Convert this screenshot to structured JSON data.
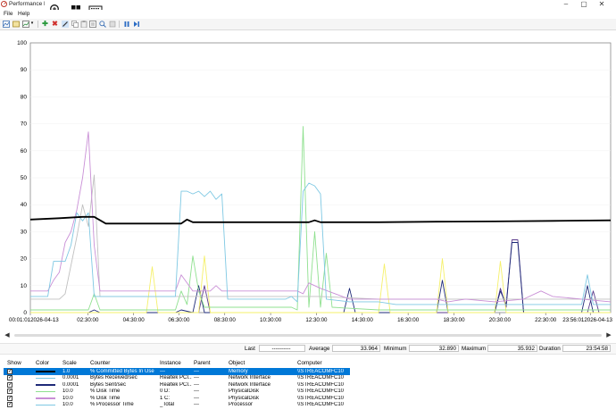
{
  "window": {
    "title": "Performance M",
    "controls": {
      "minimize": "–",
      "maximize": "▢",
      "close": "✕"
    }
  },
  "menu": {
    "items": [
      "File",
      "Help"
    ]
  },
  "chart_data": {
    "type": "line",
    "ylim": [
      0,
      100
    ],
    "yticks": [
      0,
      10,
      20,
      30,
      40,
      50,
      60,
      70,
      80,
      90,
      100
    ],
    "xlim": [
      0,
      100
    ],
    "xtick_labels": [
      {
        "x": 0,
        "label": "00:01:012026-04-13"
      },
      {
        "x": 9.9,
        "label": "02:30:00"
      },
      {
        "x": 17.8,
        "label": "04:30:00"
      },
      {
        "x": 25.6,
        "label": "06:30:00"
      },
      {
        "x": 33.5,
        "label": "08:30:00"
      },
      {
        "x": 41.4,
        "label": "10:30:00"
      },
      {
        "x": 49.3,
        "label": "12:30:00"
      },
      {
        "x": 57.2,
        "label": "14:30:00"
      },
      {
        "x": 65.1,
        "label": "16:30:00"
      },
      {
        "x": 73.0,
        "label": "18:30:00"
      },
      {
        "x": 80.9,
        "label": "20:30:00"
      },
      {
        "x": 88.8,
        "label": "22:30:00"
      },
      {
        "x": 96.5,
        "label": "23:56:012026-04-13"
      }
    ],
    "series": [
      {
        "color": "#000000",
        "points": [
          [
            0,
            34.5
          ],
          [
            5,
            35
          ],
          [
            9,
            35.5
          ],
          [
            11,
            35.5
          ],
          [
            13,
            33
          ],
          [
            20,
            33
          ],
          [
            26,
            33
          ],
          [
            27,
            34.5
          ],
          [
            28,
            33.5
          ],
          [
            40,
            33.5
          ],
          [
            48,
            33.5
          ],
          [
            49,
            34.2
          ],
          [
            50,
            33.5
          ],
          [
            60,
            33.5
          ],
          [
            70,
            33.7
          ],
          [
            80,
            33.8
          ],
          [
            90,
            34
          ],
          [
            100,
            34.2
          ]
        ]
      },
      {
        "color": "#7ec8e3",
        "points": [
          [
            0,
            6
          ],
          [
            3,
            6
          ],
          [
            4,
            19
          ],
          [
            6,
            19
          ],
          [
            7,
            25
          ],
          [
            8,
            37
          ],
          [
            9,
            34
          ],
          [
            10,
            37
          ],
          [
            11,
            6
          ],
          [
            12,
            6
          ],
          [
            20,
            6
          ],
          [
            25,
            6
          ],
          [
            26,
            45
          ],
          [
            27,
            45
          ],
          [
            28,
            44
          ],
          [
            29,
            45
          ],
          [
            30,
            43
          ],
          [
            31,
            45
          ],
          [
            32,
            42
          ],
          [
            33,
            44
          ],
          [
            34,
            5
          ],
          [
            41,
            5
          ],
          [
            44,
            5
          ],
          [
            45,
            6
          ],
          [
            46,
            4
          ],
          [
            47,
            45
          ],
          [
            48,
            48
          ],
          [
            49,
            47
          ],
          [
            50,
            44
          ],
          [
            51,
            5
          ],
          [
            55,
            4
          ],
          [
            60,
            4
          ],
          [
            63,
            3
          ],
          [
            70,
            3
          ],
          [
            75,
            3
          ],
          [
            80,
            3
          ],
          [
            85,
            3
          ],
          [
            90,
            3
          ],
          [
            95,
            3
          ],
          [
            96,
            14
          ],
          [
            97,
            3
          ],
          [
            100,
            3
          ]
        ]
      },
      {
        "color": "#c98fd6",
        "points": [
          [
            0,
            8
          ],
          [
            3,
            8
          ],
          [
            4,
            12
          ],
          [
            5,
            15
          ],
          [
            6,
            26
          ],
          [
            7,
            30
          ],
          [
            8,
            38
          ],
          [
            9,
            50
          ],
          [
            10,
            67
          ],
          [
            11,
            25
          ],
          [
            12,
            8
          ],
          [
            13,
            8
          ],
          [
            20,
            8
          ],
          [
            25,
            8
          ],
          [
            26,
            14
          ],
          [
            27,
            11
          ],
          [
            28,
            8
          ],
          [
            31,
            8
          ],
          [
            32,
            10
          ],
          [
            33,
            8
          ],
          [
            40,
            8
          ],
          [
            46,
            8
          ],
          [
            47,
            7
          ],
          [
            48,
            11
          ],
          [
            50,
            9
          ],
          [
            55,
            5
          ],
          [
            60,
            5
          ],
          [
            70,
            5
          ],
          [
            72,
            4
          ],
          [
            75,
            5
          ],
          [
            80,
            4
          ],
          [
            85,
            5
          ],
          [
            88,
            8
          ],
          [
            90,
            6
          ],
          [
            95,
            5
          ],
          [
            100,
            4
          ]
        ]
      },
      {
        "color": "#c0c0c0",
        "points": [
          [
            0,
            5
          ],
          [
            5,
            5
          ],
          [
            6,
            7
          ],
          [
            8,
            28
          ],
          [
            9,
            40
          ],
          [
            10,
            32
          ],
          [
            11,
            51
          ],
          [
            12,
            6
          ],
          [
            20,
            6
          ],
          [
            26,
            6
          ],
          [
            30,
            6
          ],
          [
            33,
            6
          ],
          [
            34,
            6
          ],
          [
            40,
            6
          ],
          [
            47,
            6
          ],
          [
            50,
            6
          ],
          [
            60,
            5
          ],
          [
            70,
            5
          ],
          [
            80,
            5
          ],
          [
            90,
            5
          ],
          [
            100,
            5
          ]
        ]
      },
      {
        "color": "#8fe08f",
        "points": [
          [
            0,
            1
          ],
          [
            10,
            1
          ],
          [
            11,
            7
          ],
          [
            12,
            1
          ],
          [
            20,
            1
          ],
          [
            25,
            1
          ],
          [
            26,
            8
          ],
          [
            27,
            3
          ],
          [
            28,
            21
          ],
          [
            29,
            8
          ],
          [
            30,
            2
          ],
          [
            35,
            2
          ],
          [
            40,
            2
          ],
          [
            45,
            2
          ],
          [
            46,
            1
          ],
          [
            47,
            69
          ],
          [
            48,
            2
          ],
          [
            49,
            30
          ],
          [
            50,
            2
          ],
          [
            51,
            22
          ],
          [
            52,
            2
          ],
          [
            60,
            1
          ],
          [
            70,
            1
          ],
          [
            80,
            1
          ],
          [
            90,
            1
          ],
          [
            100,
            1
          ]
        ]
      },
      {
        "color": "#f5f06a",
        "points": [
          [
            0,
            0
          ],
          [
            20,
            0
          ],
          [
            21,
            17
          ],
          [
            22,
            0
          ],
          [
            29,
            0
          ],
          [
            30,
            21
          ],
          [
            31,
            0
          ],
          [
            40,
            0
          ],
          [
            50,
            0
          ],
          [
            60,
            0
          ],
          [
            61,
            18
          ],
          [
            62,
            0
          ],
          [
            70,
            0
          ],
          [
            71,
            20
          ],
          [
            72,
            0
          ],
          [
            80,
            0
          ],
          [
            81,
            19
          ],
          [
            82,
            0
          ],
          [
            90,
            0
          ],
          [
            100,
            0
          ]
        ]
      },
      {
        "color": "#1e2a78",
        "points": [
          [
            0,
            0
          ],
          [
            10,
            0
          ],
          [
            11,
            1
          ],
          [
            12,
            0
          ],
          [
            25,
            0
          ],
          [
            26,
            1
          ],
          [
            28,
            0
          ],
          [
            29,
            10
          ],
          [
            30,
            0
          ],
          [
            50,
            0
          ],
          [
            54,
            0
          ],
          [
            55,
            9
          ],
          [
            56,
            0
          ],
          [
            70,
            0
          ],
          [
            71,
            12
          ],
          [
            72,
            0
          ],
          [
            80,
            0
          ],
          [
            81,
            8
          ],
          [
            82,
            3
          ],
          [
            83,
            26
          ],
          [
            84,
            26
          ],
          [
            85,
            0
          ],
          [
            95,
            0
          ],
          [
            96,
            10
          ],
          [
            97,
            0
          ],
          [
            100,
            0
          ]
        ]
      },
      {
        "color": "#5b3b8c",
        "points": [
          [
            0,
            0
          ],
          [
            20,
            0
          ],
          [
            29,
            0
          ],
          [
            30,
            10
          ],
          [
            31,
            0
          ],
          [
            70,
            0
          ],
          [
            80,
            0
          ],
          [
            81,
            9
          ],
          [
            82,
            2
          ],
          [
            83,
            27
          ],
          [
            84,
            27
          ],
          [
            85,
            0
          ],
          [
            96,
            0
          ],
          [
            97,
            8
          ],
          [
            98,
            0
          ],
          [
            100,
            0
          ]
        ]
      }
    ]
  },
  "stats": {
    "last_label": "Last",
    "last_value": "----------",
    "average_label": "Average",
    "average_value": "33.964",
    "minimum_label": "Minimum",
    "minimum_value": "32.890",
    "maximum_label": "Maximum",
    "maximum_value": "35.932",
    "duration_label": "Duration",
    "duration_value": "23:54:58"
  },
  "legend": {
    "headers": {
      "show": "Show",
      "color": "Color",
      "scale": "Scale",
      "counter": "Counter",
      "instance": "Instance",
      "parent": "Parent",
      "object": "Object",
      "computer": "Computer"
    },
    "rows": [
      {
        "color": "#000000",
        "scale": "1.0",
        "counter": "% Committed Bytes In Use",
        "instance": "---",
        "parent": "---",
        "object": "Memory",
        "computer": "\\\\STREACOMFC10",
        "selected": true
      },
      {
        "color": "#7ec8e3",
        "scale": "0.0001",
        "counter": "Bytes Received/sec",
        "instance": "Realtek PCI...",
        "parent": "---",
        "object": "Network Interface",
        "computer": "\\\\STREACOMFC10"
      },
      {
        "color": "#1e2a78",
        "scale": "0.0001",
        "counter": "Bytes Sent/sec",
        "instance": "Realtek PCI...",
        "parent": "---",
        "object": "Network Interface",
        "computer": "\\\\STREACOMFC10"
      },
      {
        "color": "#8fe08f",
        "scale": "10.0",
        "counter": "% Disk Time",
        "instance": "0 D:",
        "parent": "---",
        "object": "PhysicalDisk",
        "computer": "\\\\STREACOMFC10"
      },
      {
        "color": "#c98fd6",
        "scale": "10.0",
        "counter": "% Disk Time",
        "instance": "1 C:",
        "parent": "---",
        "object": "PhysicalDisk",
        "computer": "\\\\STREACOMFC10"
      },
      {
        "color": "#7ec8e3",
        "scale": "10.0",
        "counter": "% Processor Time",
        "instance": "_Total",
        "parent": "---",
        "object": "Processor",
        "computer": "\\\\STREACOMFC10"
      }
    ]
  }
}
